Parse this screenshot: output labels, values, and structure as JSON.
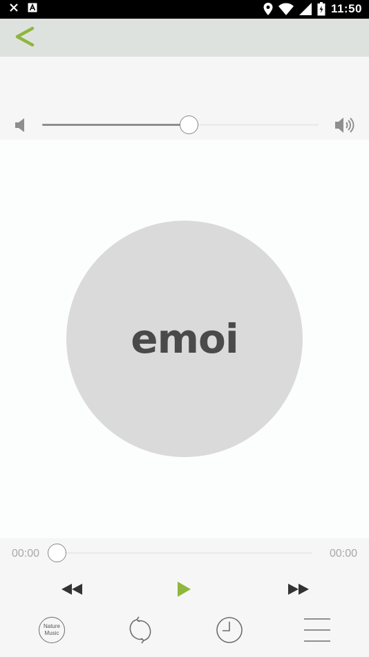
{
  "status_bar": {
    "time": "11:50",
    "left_icons": [
      "close-notification-icon",
      "a-notification-icon"
    ],
    "right_icons": [
      "location-icon",
      "wifi-icon",
      "signal-icon",
      "battery-icon"
    ]
  },
  "header": {
    "back_icon": "chevron-left-icon",
    "accent_color": "#8fb63d"
  },
  "volume": {
    "level": 0.53,
    "low_icon": "volume-low-icon",
    "high_icon": "volume-high-icon"
  },
  "disc": {
    "logo_text": "emoi"
  },
  "playback": {
    "current_time": "00:00",
    "total_time": "00:00",
    "progress": 0.0,
    "play_color": "#8fb63d"
  },
  "toolbar": {
    "nature_line1": "Nature",
    "nature_line2": "Music",
    "repeat_icon": "repeat-icon",
    "timer_icon": "clock-icon",
    "menu_icon": "menu-icon"
  }
}
